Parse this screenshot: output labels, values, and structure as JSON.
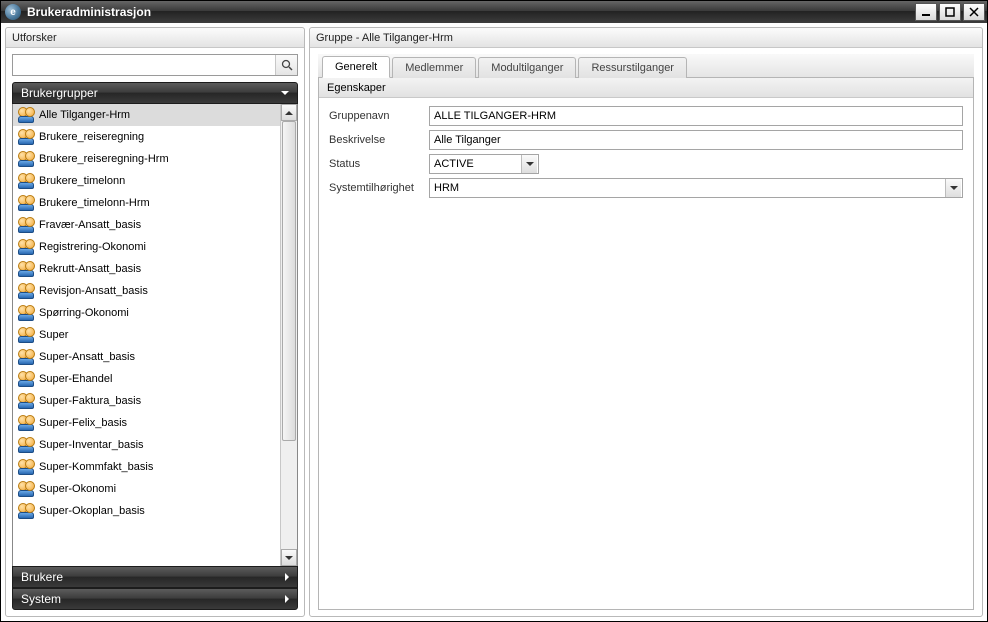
{
  "window": {
    "title": "Brukeradministrasjon"
  },
  "explorer": {
    "title": "Utforsker",
    "search_placeholder": "",
    "accordion": {
      "brukergrupper": "Brukergrupper",
      "brukere": "Brukere",
      "system": "System"
    },
    "groups": [
      "Alle Tilganger-Hrm",
      "Brukere_reiseregning",
      "Brukere_reiseregning-Hrm",
      "Brukere_timelonn",
      "Brukere_timelonn-Hrm",
      "Fravær-Ansatt_basis",
      "Registrering-Okonomi",
      "Rekrutt-Ansatt_basis",
      "Revisjon-Ansatt_basis",
      "Spørring-Okonomi",
      "Super",
      "Super-Ansatt_basis",
      "Super-Ehandel",
      "Super-Faktura_basis",
      "Super-Felix_basis",
      "Super-Inventar_basis",
      "Super-Kommfakt_basis",
      "Super-Okonomi",
      "Super-Okoplan_basis"
    ],
    "selected_index": 0
  },
  "detail": {
    "title": "Gruppe - Alle Tilganger-Hrm",
    "tabs": {
      "general": "Generelt",
      "members": "Medlemmer",
      "module_access": "Modultilganger",
      "resource_access": "Ressurstilganger"
    },
    "fieldset_title": "Egenskaper",
    "fields": {
      "gruppenavn": {
        "label": "Gruppenavn",
        "value": "ALLE TILGANGER-HRM"
      },
      "beskrivelse": {
        "label": "Beskrivelse",
        "value": "Alle Tilganger"
      },
      "status": {
        "label": "Status",
        "value": "ACTIVE"
      },
      "systemtilhorighet": {
        "label": "Systemtilhørighet",
        "value": "HRM"
      }
    }
  }
}
